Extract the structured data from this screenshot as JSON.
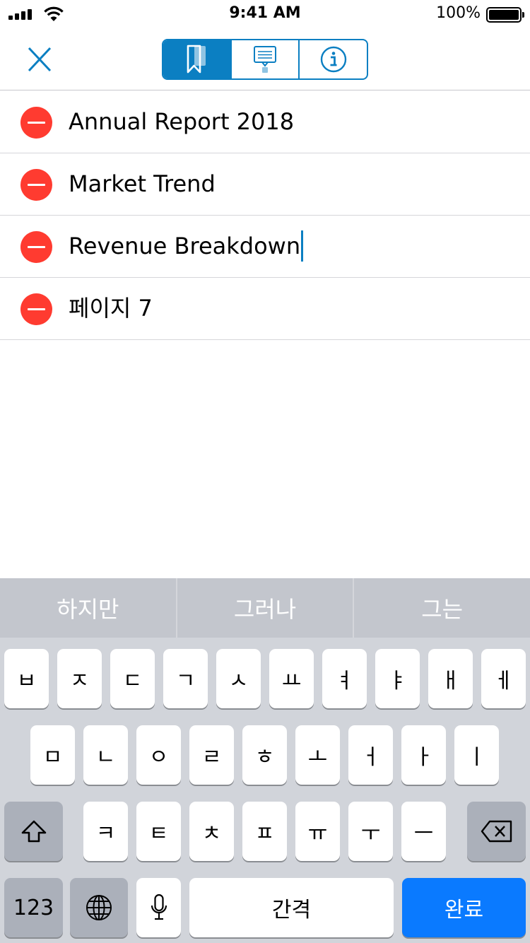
{
  "status_bar": {
    "time": "9:41 AM",
    "battery_percent": "100%",
    "battery_level": 1.0,
    "signal_icon": "cellular-signal-icon",
    "wifi_icon": "wifi-icon",
    "battery_icon": "battery-icon"
  },
  "nav": {
    "close_icon": "close-x-icon",
    "segments": [
      {
        "icon": "bookmark-icon",
        "selected": true
      },
      {
        "icon": "comment-icon",
        "selected": false
      },
      {
        "icon": "info-icon",
        "selected": false
      }
    ],
    "accent_color": "#0b7fc2"
  },
  "list": {
    "items": [
      {
        "label": "Annual Report 2018"
      },
      {
        "label": "Market Trend"
      },
      {
        "label": "Revenue Breakdown",
        "editing": true
      },
      {
        "label": "페이지 7"
      }
    ],
    "delete_color": "#ff3b30"
  },
  "keyboard": {
    "suggestions": [
      "하지만",
      "그러나",
      "그는"
    ],
    "row1": [
      "ㅂ",
      "ㅈ",
      "ㄷ",
      "ㄱ",
      "ㅅ",
      "ㅛ",
      "ㅕ",
      "ㅑ",
      "ㅐ",
      "ㅔ"
    ],
    "row2": [
      "ㅁ",
      "ㄴ",
      "ㅇ",
      "ㄹ",
      "ㅎ",
      "ㅗ",
      "ㅓ",
      "ㅏ",
      "ㅣ"
    ],
    "row3": [
      "ㅋ",
      "ㅌ",
      "ㅊ",
      "ㅍ",
      "ㅠ",
      "ㅜ",
      "ㅡ"
    ],
    "shift_icon": "shift-arrow-icon",
    "delete_icon": "backspace-icon",
    "numbers_label": "123",
    "globe_icon": "globe-icon",
    "mic_icon": "microphone-icon",
    "space_label": "간격",
    "return_label": "완료"
  }
}
